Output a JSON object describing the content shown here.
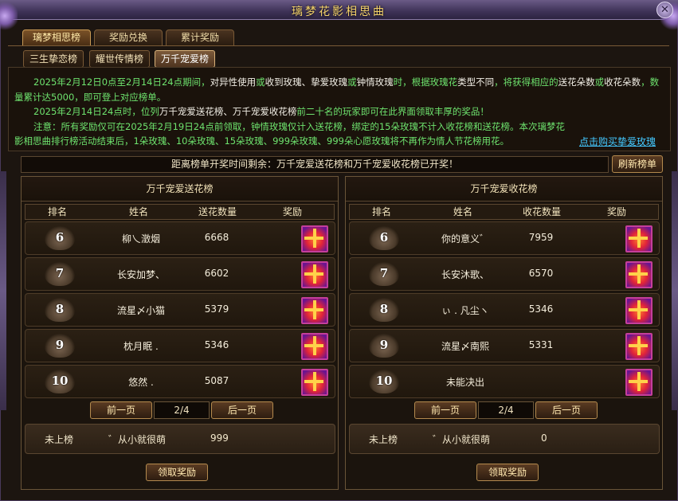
{
  "window": {
    "title": "璃梦花影相思曲",
    "close_label": "✕"
  },
  "tabs": [
    "璃梦相思榜",
    "奖励兑换",
    "累计奖励"
  ],
  "subtabs": [
    "三生挚恋榜",
    "耀世传情榜",
    "万千宠爱榜"
  ],
  "info": {
    "p1": {
      "a": "2025年2月12日0点至2月14日24点期间，",
      "b": "对异性使用",
      "c": "或",
      "d": "收到玫瑰、挚爱玫瑰",
      "e": "或",
      "f": "钟情玫瑰",
      "g": "时，根据玫瑰花",
      "h": "类型不同",
      "i": "，将获得相应的",
      "j": "送花朵数",
      "k": "或",
      "l": "收花朵数",
      "m": "，数量累计达5000，即可登上对应榜单。"
    },
    "p2": {
      "a": "2025年2月14日24点时，位列",
      "b": "万千宠爱送花榜、万千宠爱收花榜",
      "c": "前二十名的玩家即可在此界面领取丰厚的奖品！"
    },
    "p3": "注意：所有奖励仅可在2025年2月19日24点前领取，钟情玫瑰仅计入送花榜，绑定的15朵玫瑰不计入收花榜和送花榜。本次璃梦花影相思曲排行榜活动结束后，1朵玫瑰、10朵玫瑰、15朵玫瑰、999朵玫瑰、999朵心愿玫瑰将不再作为情人节花榜用花。",
    "buy_link": "点击购买挚爱玫瑰"
  },
  "notice": "距离榜单开奖时间剩余：万千宠爱送花榜和万千宠爱收花榜已开奖！",
  "refresh_label": "刷新榜单",
  "boards": [
    {
      "title": "万千宠爱送花榜",
      "headers": [
        "排名",
        "姓名",
        "送花数量",
        "奖励"
      ],
      "rows": [
        {
          "rank": "6",
          "name": "柳乀澂烟",
          "count": "6668"
        },
        {
          "rank": "7",
          "name": "长安加梦、",
          "count": "6602"
        },
        {
          "rank": "8",
          "name": "流星〆小猫",
          "count": "5379"
        },
        {
          "rank": "9",
          "name": "枕月眠 .",
          "count": "5346"
        },
        {
          "rank": "10",
          "name": "悠然 .",
          "count": "5087"
        }
      ],
      "pager": {
        "prev": "前一页",
        "page": "2/4",
        "next": "后一页"
      },
      "mine": {
        "status": "未上榜",
        "name": "゛从小就很萌",
        "count": "999"
      },
      "claim_label": "领取奖励"
    },
    {
      "title": "万千宠爱收花榜",
      "headers": [
        "排名",
        "姓名",
        "收花数量",
        "奖励"
      ],
      "rows": [
        {
          "rank": "6",
          "name": "你的意义゛",
          "count": "7959"
        },
        {
          "rank": "7",
          "name": "长安沐歌、",
          "count": "6570"
        },
        {
          "rank": "8",
          "name": "ぃ . 凡尘ヽ",
          "count": "5346"
        },
        {
          "rank": "9",
          "name": "流星〆南熙",
          "count": "5331"
        },
        {
          "rank": "10",
          "name": "未能决出",
          "count": ""
        }
      ],
      "pager": {
        "prev": "前一页",
        "page": "2/4",
        "next": "后一页"
      },
      "mine": {
        "status": "未上榜",
        "name": "゛从小就很萌",
        "count": "0"
      },
      "claim_label": "领取奖励"
    }
  ]
}
